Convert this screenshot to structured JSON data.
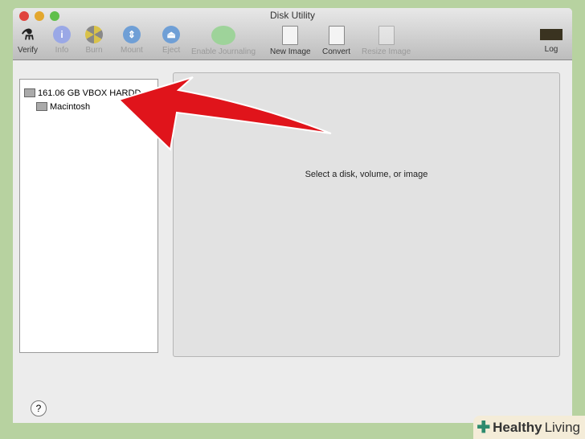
{
  "window": {
    "title": "Disk Utility"
  },
  "toolbar": [
    {
      "label": "Verify",
      "enabled": true
    },
    {
      "label": "Info",
      "enabled": false
    },
    {
      "label": "Burn",
      "enabled": false
    },
    {
      "label": "Mount",
      "enabled": false
    },
    {
      "label": "Eject",
      "enabled": false
    },
    {
      "label": "Enable Journaling",
      "enabled": false
    },
    {
      "label": "New Image",
      "enabled": true
    },
    {
      "label": "Convert",
      "enabled": true
    },
    {
      "label": "Resize Image",
      "enabled": false
    },
    {
      "label": "Log",
      "enabled": true
    }
  ],
  "sidebar": {
    "disk": "161.06 GB VBOX HARDD...",
    "volume": "Macintosh"
  },
  "main": {
    "message": "Select a disk, volume, or image"
  },
  "help": "?",
  "watermark": {
    "bold": "Healthy",
    "regular": " Living"
  },
  "colors": {
    "arrow": "#e0141b",
    "accent_green": "#2e8b6e"
  }
}
